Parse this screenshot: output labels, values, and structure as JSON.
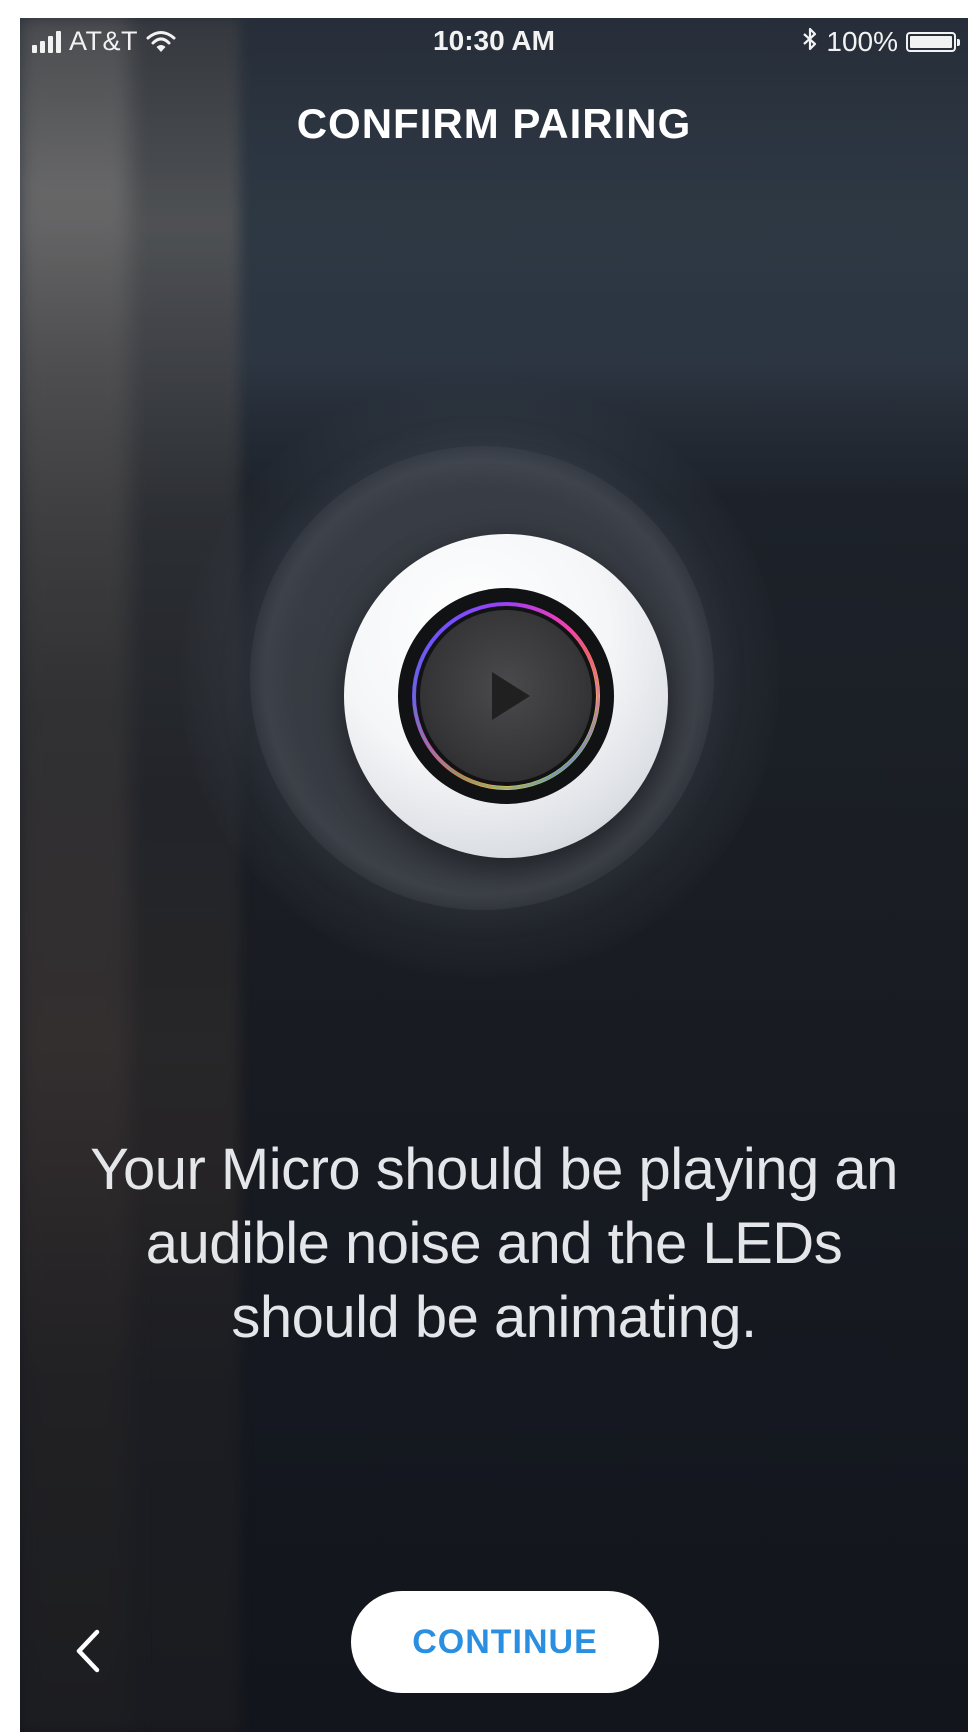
{
  "status_bar": {
    "carrier": "AT&T",
    "time": "10:30 AM",
    "bluetooth_icon": "bluetooth-icon",
    "battery_percent": "100%",
    "battery_level": 1.0,
    "signal_bars": 4
  },
  "header": {
    "title": "CONFIRM PAIRING"
  },
  "illustration": {
    "device_icon": "speaker-device-icon",
    "play_icon": "play-icon"
  },
  "message": {
    "text": "Your Micro should be playing an audible noise and the LEDs should be animating."
  },
  "footer": {
    "back_icon": "chevron-left-icon",
    "continue_label": "CONTINUE"
  },
  "colors": {
    "accent": "#2a8fe0",
    "button_bg": "#ffffff",
    "text": "#e4e6ea"
  }
}
